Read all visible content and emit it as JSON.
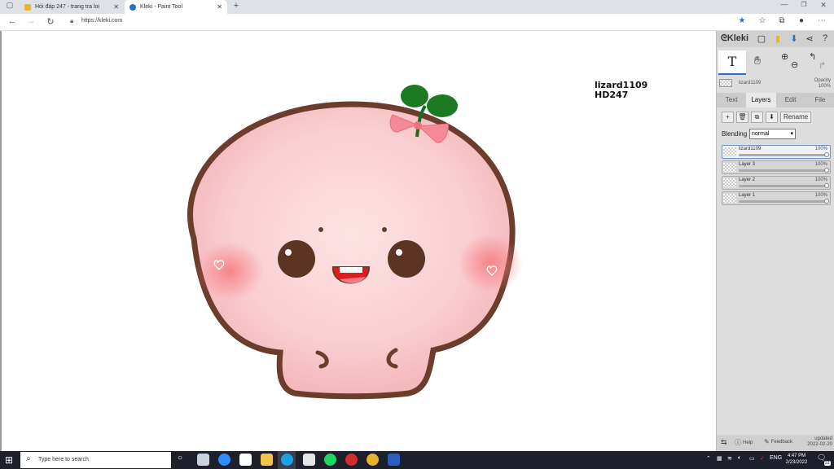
{
  "browser": {
    "tabs": [
      {
        "title": "Hỏi đáp 247 - trang tra loi",
        "close": "✕"
      },
      {
        "title": "Kleki - Paint Tool",
        "close": "✕"
      }
    ],
    "new_tab": "+",
    "url": "https://kleki.com",
    "colors": {
      "tabbar": "#dee1e6",
      "accent": "#2a6ec7"
    }
  },
  "canvas": {
    "text_line1": "lizard1109",
    "text_line2": "HD247"
  },
  "panel": {
    "logo": "Kleki",
    "brush_name": "lizard1109",
    "opacity_label": "Opacity",
    "opacity_value": "100%",
    "tabs": [
      "Text",
      "Layers",
      "Edit",
      "File"
    ],
    "active_tab": "Layers",
    "rename_label": "Rename",
    "blending_label": "Blending",
    "blending_value": "normal",
    "layers": [
      {
        "name": "lizard1109",
        "opacity": "100%",
        "active": true
      },
      {
        "name": "Layer 3",
        "opacity": "100%",
        "active": false
      },
      {
        "name": "Layer 2",
        "opacity": "100%",
        "active": false
      },
      {
        "name": "Layer 1",
        "opacity": "100%",
        "active": false
      }
    ],
    "help_label": "Help",
    "feedback_label": "Feedback",
    "updated_label": "updated",
    "updated_date": "2022-02-20"
  },
  "taskbar": {
    "search_placeholder": "Type here to search",
    "lang": "ENG",
    "time": "4:47 PM",
    "date": "2/23/2022",
    "badge": "22"
  }
}
